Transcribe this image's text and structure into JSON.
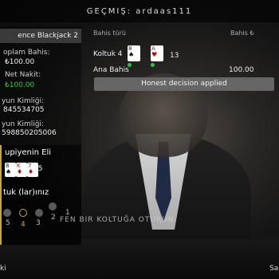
{
  "header": {
    "title": "GEÇMIŞ: ardaas111"
  },
  "colors": {
    "green": "#33c24b",
    "gold": "#c9a243",
    "panel_dark": "#3a3a3a"
  },
  "left": {
    "game_name": "ence Blackjack 2",
    "total_bet_label": "oplam Bahis:",
    "total_bet_value": "₺100.00",
    "net_label": "Net Nakit:",
    "net_value": "₺100.00",
    "game_id_label_1": "yun Kimliği:",
    "game_id_value_1": "845534705",
    "game_id_label_2": "yun Kimliği:",
    "game_id_value_2": "598850205006",
    "dealer_hand_label": "upiyenin Eli",
    "dealer_total": "25",
    "seats_label": "tuk (lar)ınız",
    "seat_numbers": [
      "5",
      "4",
      "3",
      "2",
      "1"
    ]
  },
  "right": {
    "col_bet_type": "Bahis türü",
    "col_bet": "Bahis ₺",
    "seat_label": "Koltuk 4",
    "seat_total": "13",
    "main_bet_label": "Ana Bahis",
    "main_bet_value": "100.00",
    "decision_label": "Honest decision applied"
  },
  "cards": {
    "player": [
      {
        "rank": "8",
        "suit": "♠"
      },
      {
        "rank": "A",
        "suit": "♥"
      }
    ],
    "dealer": [
      {
        "rank": "8",
        "suit": "♠"
      },
      {
        "rank": "K",
        "suit": "♦"
      },
      {
        "rank": "7",
        "suit": "♦"
      }
    ]
  },
  "table_text": "FEN BIR KOLTUĞA OTURUN",
  "footer": {
    "left": "ki",
    "right": "Sa"
  }
}
